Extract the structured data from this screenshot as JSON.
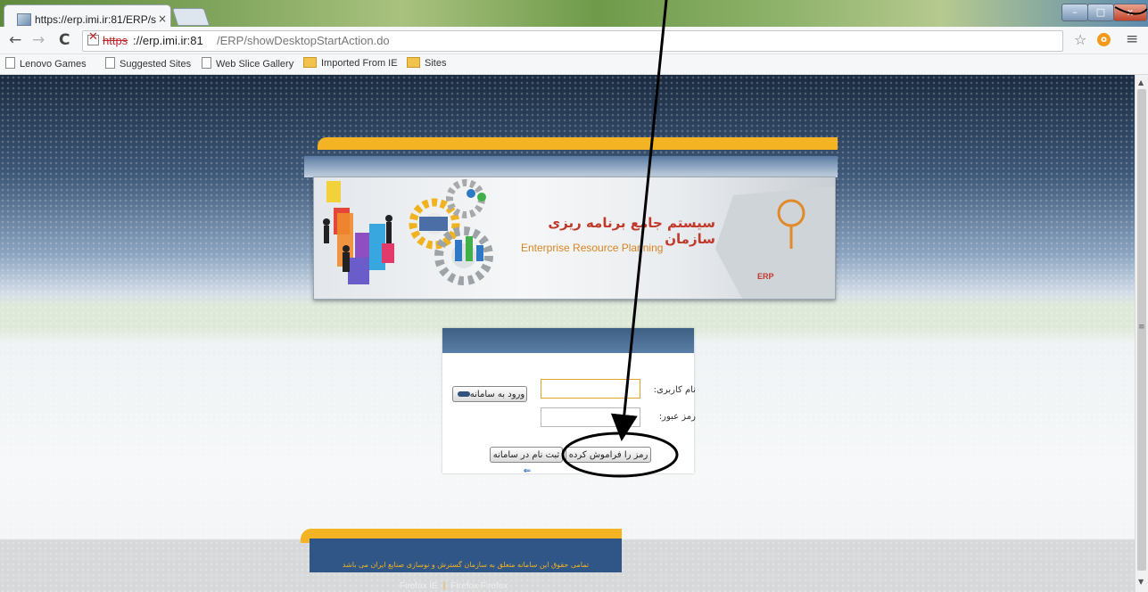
{
  "browser": {
    "tab_title": "https://erp.imi.ir:81/ERP/s",
    "tab_close": "×",
    "url_protocol": "https",
    "url_host": "://erp.imi.ir:81",
    "url_path": "/ERP/showDesktopStartAction.do",
    "window_min": "–",
    "window_max": "□",
    "window_close": "x"
  },
  "bookmarks": [
    {
      "label": "Lenovo Games",
      "icon": "page"
    },
    {
      "label": "Suggested Sites",
      "icon": "page"
    },
    {
      "label": "Web Slice Gallery",
      "icon": "page"
    },
    {
      "label": "Imported From IE",
      "icon": "folder"
    },
    {
      "label": "Sites",
      "icon": "folder"
    }
  ],
  "banner": {
    "title_fa": "سیستم جامع برنامه ریزی سازمان",
    "subtitle": "Enterprise Resource Planning",
    "badge": "ERP"
  },
  "login": {
    "username_label": "نام کاربری:",
    "password_label": "رمز عبور:",
    "username_value": "",
    "password_value": "",
    "login_button": "ورود به سامانه",
    "register_button": "ثبت نام در سامانه",
    "forgot_button": "رمز را فراموش کرده"
  },
  "footer": {
    "text": "تمامی حقوق این سامانه متعلق به سازمان گسترش و نوسازی صنایع ایران می باشد",
    "link_ie": "Firefox IE",
    "link_ff": "Firefox Firefox"
  },
  "colors": {
    "accent": "#f3b322",
    "header_blue": "#2f5686",
    "annotation": "#000000"
  }
}
